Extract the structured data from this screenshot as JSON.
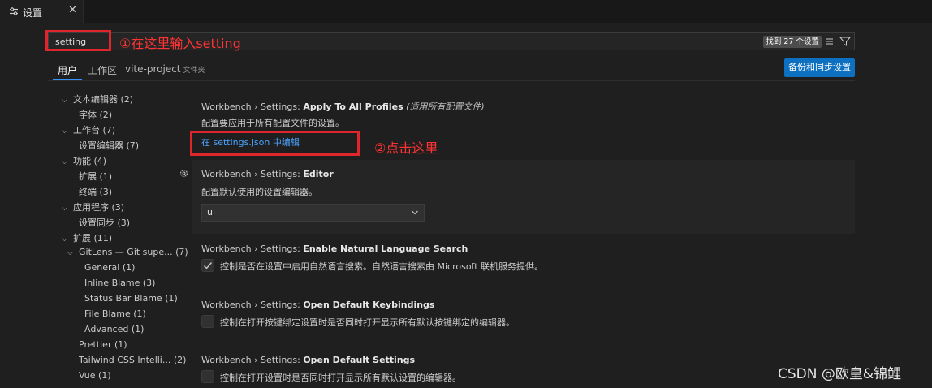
{
  "tab": {
    "icon": "settings-icon",
    "title": "设置",
    "close": "✕"
  },
  "search": {
    "value": "setting",
    "count": "找到 27 个设置",
    "clear_icon": "clear-filter-icon",
    "filter_icon": "filter-icon"
  },
  "annotations": {
    "step1": "①在这里输入setting",
    "step2": "②点击这里"
  },
  "scope_tabs": {
    "user": "用户",
    "workspace": "工作区",
    "folder": "vite-project",
    "folder_suffix": "文件夹"
  },
  "backup_button": "备份和同步设置",
  "toc": [
    {
      "label": "文本编辑器",
      "count": "(2)"
    },
    {
      "label": "字体",
      "count": "(2)"
    },
    {
      "label": "工作台",
      "count": "(7)"
    },
    {
      "label": "设置编辑器",
      "count": "(7)"
    },
    {
      "label": "功能",
      "count": "(4)"
    },
    {
      "label": "扩展",
      "count": "(1)"
    },
    {
      "label": "终端",
      "count": "(3)"
    },
    {
      "label": "应用程序",
      "count": "(3)"
    },
    {
      "label": "设置同步",
      "count": "(3)"
    },
    {
      "label": "扩展",
      "count": "(11)"
    },
    {
      "label": "GitLens — Git supe...",
      "count": "(7)"
    },
    {
      "label": "General",
      "count": "(1)"
    },
    {
      "label": "Inline Blame",
      "count": "(3)"
    },
    {
      "label": "Status Bar Blame",
      "count": "(1)"
    },
    {
      "label": "File Blame",
      "count": "(1)"
    },
    {
      "label": "Advanced",
      "count": "(1)"
    },
    {
      "label": "Prettier",
      "count": "(1)"
    },
    {
      "label": "Tailwind CSS Intelli...",
      "count": "(2)"
    },
    {
      "label": "Vue",
      "count": "(1)"
    }
  ],
  "settings": [
    {
      "prefix": "Workbench › Settings: ",
      "name": "Apply To All Profiles",
      "tag": "(适用所有配置文件)",
      "desc": "配置要应用于所有配置文件的设置。",
      "link": "在 settings.json 中编辑"
    },
    {
      "prefix": "Workbench › Settings: ",
      "name": "Editor",
      "desc": "配置默认使用的设置编辑器。",
      "value": "ui"
    },
    {
      "prefix": "Workbench › Settings: ",
      "name": "Enable Natural Language Search",
      "desc": "控制是否在设置中启用自然语言搜索。自然语言搜索由 Microsoft 联机服务提供。",
      "checked": true
    },
    {
      "prefix": "Workbench › Settings: ",
      "name": "Open Default Keybindings",
      "desc": "控制在打开按键绑定设置时是否同时打开显示所有默认按键绑定的编辑器。",
      "checked": false
    },
    {
      "prefix": "Workbench › Settings: ",
      "name": "Open Default Settings",
      "desc": "控制在打开设置时是否同时打开显示所有默认设置的编辑器。",
      "checked": false
    }
  ],
  "watermark": "CSDN @欧皇&锦鲤"
}
